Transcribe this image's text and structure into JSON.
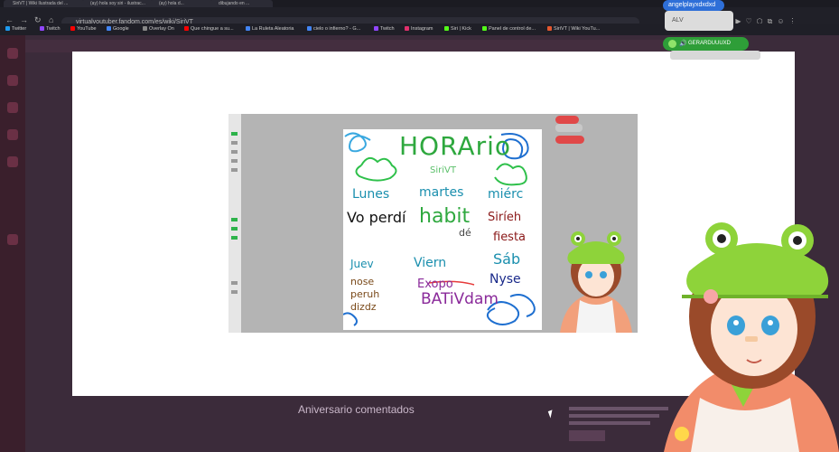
{
  "browser": {
    "tabs": [
      "SiriVT | Wiki Ilustrada del ...",
      "(ay) hola soy siri - ilustrac...",
      "(ay) hola d...",
      "dibujando en ..."
    ],
    "address": "virtualyoutuber.fandom.com/es/wiki/SiriVT",
    "bookmarks": [
      {
        "label": "Twitter",
        "color": "#1d9bf0"
      },
      {
        "label": "Twitch",
        "color": "#9146ff"
      },
      {
        "label": "YouTube",
        "color": "#ff0000"
      },
      {
        "label": "Google",
        "color": "#4285f4"
      },
      {
        "label": "Overlay On",
        "color": "#888888"
      },
      {
        "label": "Que chingue a su...",
        "color": "#ff0000"
      },
      {
        "label": "La Ruleta Aleatoria",
        "color": "#4285f4"
      },
      {
        "label": "cielo o infierno? - G...",
        "color": "#4285f4"
      },
      {
        "label": "Twitch",
        "color": "#9146ff"
      },
      {
        "label": "Instagram",
        "color": "#e1306c"
      },
      {
        "label": "Siri | Kick",
        "color": "#53fc18"
      },
      {
        "label": "Panel de control de...",
        "color": "#53fc18"
      },
      {
        "label": "SiriVT | Wiki YouTu...",
        "color": "#e4572e"
      }
    ]
  },
  "overlay": {
    "chat_user": "angelplayxdxdxd",
    "chat_message": "ALV",
    "voice_user": "GERARDUUUXD"
  },
  "drawing": {
    "title": "HORArio",
    "signature": "SiriVT",
    "days_row1": [
      "Lunes",
      "martes",
      "miérc"
    ],
    "lines": [
      "Vo perdí",
      "habit",
      "Siríeh",
      "dé",
      "fiesta"
    ],
    "days_row2": [
      "Juev",
      "Viern",
      "Sáb"
    ],
    "notes": [
      "nose",
      "peruh",
      "dizdz",
      "Exopo",
      "BATiVdam",
      "Nyse"
    ]
  },
  "page": {
    "section_title": "Aniversario comentados"
  },
  "colors": {
    "accent_red": "#e04848",
    "voice_green": "#2e9e38",
    "chat_blue": "#2e6fd8"
  }
}
